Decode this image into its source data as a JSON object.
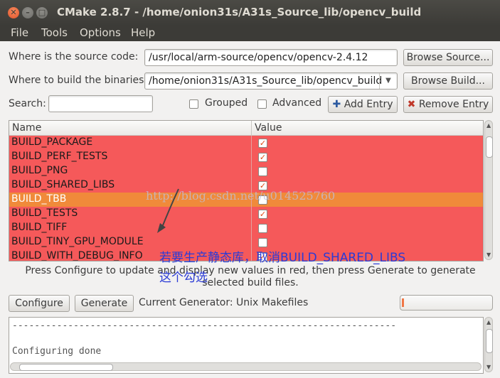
{
  "window": {
    "title": "CMake 2.8.7 - /home/onion31s/A31s_Source_lib/opencv_build"
  },
  "menu": [
    "File",
    "Tools",
    "Options",
    "Help"
  ],
  "source": {
    "label": "Where is the source code:",
    "value": "/usr/local/arm-source/opencv/opencv-2.4.12",
    "button": "Browse Source..."
  },
  "build": {
    "label": "Where to build the binaries:",
    "value": "/home/onion31s/A31s_Source_lib/opencv_build",
    "button": "Browse Build..."
  },
  "search": {
    "label": "Search:",
    "value": ""
  },
  "options": {
    "grouped": "Grouped",
    "advanced": "Advanced",
    "add_entry": "Add Entry",
    "remove_entry": "Remove Entry"
  },
  "table": {
    "columns": [
      "Name",
      "Value"
    ],
    "rows": [
      {
        "name": "BUILD_PACKAGE",
        "checked": true
      },
      {
        "name": "BUILD_PERF_TESTS",
        "checked": true
      },
      {
        "name": "BUILD_PNG",
        "checked": false
      },
      {
        "name": "BUILD_SHARED_LIBS",
        "checked": true
      },
      {
        "name": "BUILD_TBB",
        "checked": false,
        "selected": true
      },
      {
        "name": "BUILD_TESTS",
        "checked": true
      },
      {
        "name": "BUILD_TIFF",
        "checked": false
      },
      {
        "name": "BUILD_TINY_GPU_MODULE",
        "checked": false
      },
      {
        "name": "BUILD_WITH_DEBUG_INFO",
        "checked": true
      }
    ]
  },
  "hint": "Press Configure to update and display new values in red, then press Generate to generate selected build files.",
  "buttons": {
    "configure": "Configure",
    "generate": "Generate"
  },
  "generator": "Current Generator: Unix Makefiles",
  "progress": 0.02,
  "output": {
    "lines": [
      "---------------------------------------------------------------------",
      "",
      "Configuring done"
    ]
  },
  "watermark": "http://blog.csdn.net/u014525760",
  "annotation": {
    "line1": "若要生产静态库，取消BUILD_SHARED_LIBS",
    "line2": "这个勾选"
  },
  "colors": {
    "new_value_row": "#f5595a",
    "selected_row": "#f08a3a",
    "annotation": "#2b3bd6"
  }
}
